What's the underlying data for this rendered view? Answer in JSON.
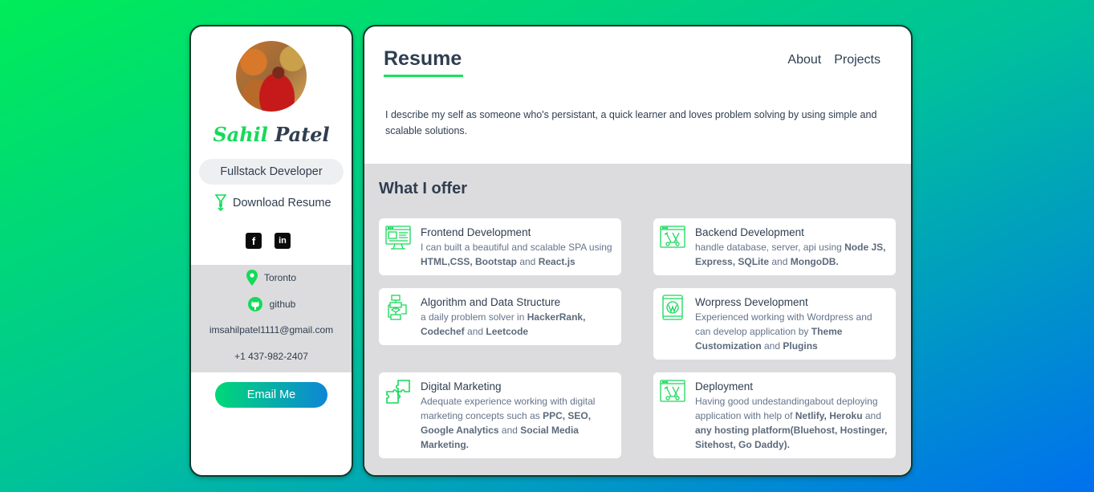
{
  "profile": {
    "first_name": "Sahil",
    "last_name": "Patel",
    "role": "Fullstack Developer",
    "download_label": "Download Resume",
    "socials": [
      {
        "icon": "facebook-icon",
        "glyph": "f"
      },
      {
        "icon": "linkedin-icon",
        "glyph": "in"
      }
    ],
    "location": "Toronto",
    "github": "github",
    "email": "imsahilpatel1111@gmail.com",
    "phone": "+1 437-982-2407",
    "email_button": "Email Me"
  },
  "header": {
    "title": "Resume",
    "nav": [
      "About",
      "Projects"
    ]
  },
  "about": {
    "text": "I describe my self as someone who's persistant, a quick learner and loves problem solving by using simple and scalable solutions."
  },
  "offer": {
    "title": "What I offer",
    "services": [
      {
        "title": "Frontend Development",
        "icon": "monitor-code-icon",
        "desc": [
          [
            "I can built a beautiful and scalable SPA using ",
            ""
          ],
          [
            "HTML,CSS, Bootstap",
            "b"
          ],
          [
            " and ",
            ""
          ],
          [
            "React.js",
            "b"
          ]
        ]
      },
      {
        "title": "Backend Development",
        "icon": "server-tools-icon",
        "desc": [
          [
            "handle database, server, api using ",
            ""
          ],
          [
            "Node JS, Express, SQLite",
            "b"
          ],
          [
            " and ",
            ""
          ],
          [
            "MongoDB.",
            "b"
          ]
        ]
      },
      {
        "title": "Algorithm and Data Structure",
        "icon": "flowchart-icon",
        "desc": [
          [
            "a daily problem solver in ",
            ""
          ],
          [
            "HackerRank, Codechef",
            "b"
          ],
          [
            " and ",
            ""
          ],
          [
            "Leetcode",
            "b"
          ]
        ]
      },
      {
        "title": "Worpress Development",
        "icon": "wordpress-tablet-icon",
        "desc": [
          [
            "Experienced working with Wordpress and can develop application by ",
            ""
          ],
          [
            "Theme Customization",
            "b"
          ],
          [
            " and ",
            ""
          ],
          [
            "Plugins",
            "b"
          ]
        ]
      },
      {
        "title": "Digital Marketing",
        "icon": "puzzle-icon",
        "desc": [
          [
            "Adequate experience working with digital marketing concepts such as ",
            ""
          ],
          [
            "PPC, SEO, Google Analytics",
            "b"
          ],
          [
            " and ",
            ""
          ],
          [
            "Social Media Marketing.",
            "b"
          ]
        ]
      },
      {
        "title": "Deployment",
        "icon": "deploy-tools-icon",
        "desc": [
          [
            "Having good undestandingabout deploying application with help of ",
            ""
          ],
          [
            "Netlify, Heroku",
            "b"
          ],
          [
            " and ",
            ""
          ],
          [
            "any hosting platform(Bluehost, Hostinger, Sitehost, Go Daddy).",
            "b"
          ]
        ]
      }
    ]
  },
  "colors": {
    "accent": "#16e35a",
    "text": "#2f3e50",
    "muted": "#64748b",
    "panel_gray": "#dcdcde"
  }
}
